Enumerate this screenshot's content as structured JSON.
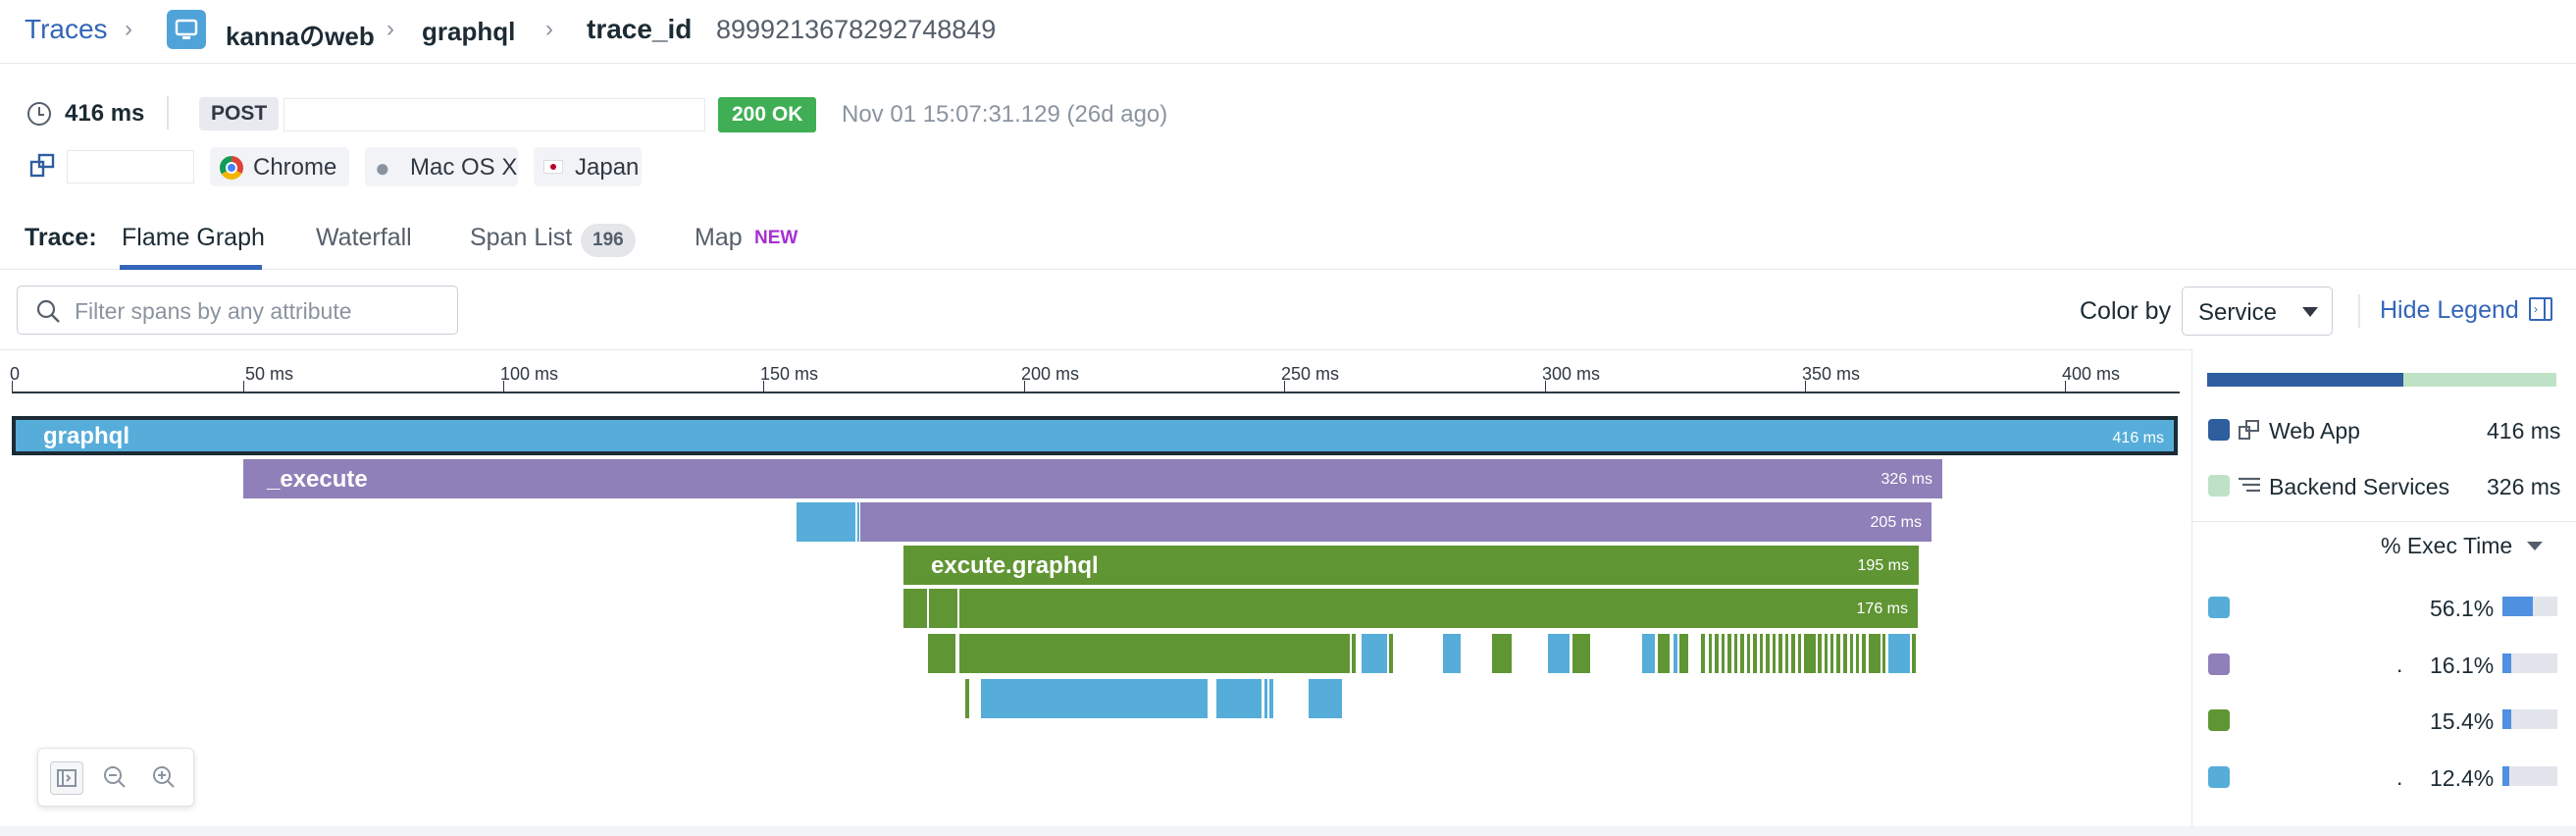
{
  "breadcrumb": {
    "root": "Traces",
    "service": "kannaのweb",
    "resource": "graphql",
    "trace_label": "trace_id",
    "trace_id": "8999213678292748849"
  },
  "summary": {
    "duration": "416 ms",
    "method": "POST",
    "status": "200 OK",
    "timestamp": "Nov 01 15:07:31.129 (26d ago)"
  },
  "tags": {
    "browser": "Chrome",
    "os": "Mac OS X",
    "country": "Japan"
  },
  "tabs": {
    "prefix": "Trace:",
    "items": [
      {
        "label": "Flame Graph"
      },
      {
        "label": "Waterfall"
      },
      {
        "label": "Span List",
        "badge": "196"
      },
      {
        "label": "Map",
        "badge": "NEW"
      }
    ]
  },
  "toolbar": {
    "search_placeholder": "Filter spans by any attribute",
    "color_by_label": "Color by",
    "color_by_value": "Service",
    "hide_legend": "Hide Legend"
  },
  "axis_ticks": [
    "0",
    "50 ms",
    "100 ms",
    "150 ms",
    "200 ms",
    "250 ms",
    "300 ms",
    "350 ms",
    "400 ms"
  ],
  "spans": {
    "root_name": "graphql",
    "root_dur": "416 ms",
    "execute_name": "_execute",
    "execute_dur": "326 ms",
    "level3_dur": "205 ms",
    "excute_name": "excute.graphql",
    "excute_dur": "195 ms",
    "level5_dur": "176 ms"
  },
  "legend": {
    "services": [
      {
        "name": "Web App",
        "value": "416 ms",
        "color": "#2f5e9e"
      },
      {
        "name": "Backend Services",
        "value": "326 ms",
        "color": "#bfe2c6"
      }
    ],
    "sort_label": "% Exec Time",
    "rows": [
      {
        "color": "#56add9",
        "label": "",
        "pct": "56.1%",
        "fill": 0.561
      },
      {
        "color": "#8f80b9",
        "label": ".",
        "pct": "16.1%",
        "fill": 0.161
      },
      {
        "color": "#609534",
        "label": "",
        "pct": "15.4%",
        "fill": 0.154
      },
      {
        "color": "#56add9",
        "label": ".",
        "pct": "12.4%",
        "fill": 0.124
      }
    ]
  },
  "colors": {
    "link": "#3366b8",
    "status_ok": "#3fae54",
    "span_blue": "#56add9",
    "span_purple": "#8f80b9",
    "span_green": "#609534"
  }
}
